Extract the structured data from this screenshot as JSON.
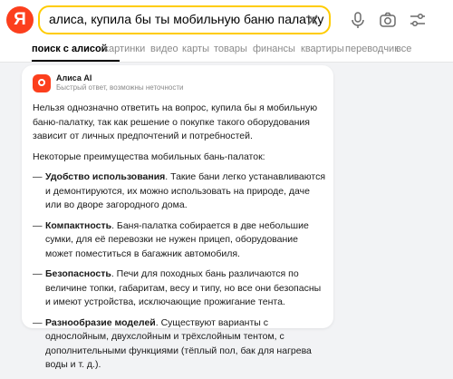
{
  "header": {
    "logo_letter": "Я",
    "search_value": "алиса, купила бы ты мобильную баню палатку",
    "accent": "#fc3f1d",
    "search_border": "#ffcc00"
  },
  "tabs": [
    {
      "label": "поиск с алисой",
      "active": true
    },
    {
      "label": "картинки"
    },
    {
      "label": "видео"
    },
    {
      "label": "карты"
    },
    {
      "label": "товары"
    },
    {
      "label": "финансы"
    },
    {
      "label": "квартиры"
    },
    {
      "label": "переводчик"
    },
    {
      "label": "все"
    }
  ],
  "alice": {
    "name": "Алиса AI",
    "subtitle": "Быстрый ответ, возможны неточности",
    "intro": "Нельзя однозначно ответить на вопрос, купила бы я мобильную баню-палатку, так как решение о покупке такого оборудования зависит от личных предпочтений и потребностей.",
    "lead": "Некоторые преимущества мобильных бань-палаток:",
    "items": [
      {
        "title": "Удобство использования",
        "text": ". Такие бани легко устанавливаются и демонтируются, их можно использовать на природе, дачe или во дворе загородного дома."
      },
      {
        "title": "Компактность",
        "text": ". Баня-палатка собирается в две небольшие сумки, для её перевозки не нужен прицеп, оборудование может поместиться в багажник автомобиля."
      },
      {
        "title": "Безопасность",
        "text": ". Печи для походных бань различаются по величине топки, габаритам, весу и типу, но все они безопасны и имеют устройства, исключающие прожигание тента."
      },
      {
        "title": "Разнообразие моделей",
        "text": ". Существуют варианты с однослойным, двухслойным и трёхслойным тентом, с дополнительными функциями (тёплый пол, бак для нагрева воды и т. д.)."
      }
    ]
  }
}
